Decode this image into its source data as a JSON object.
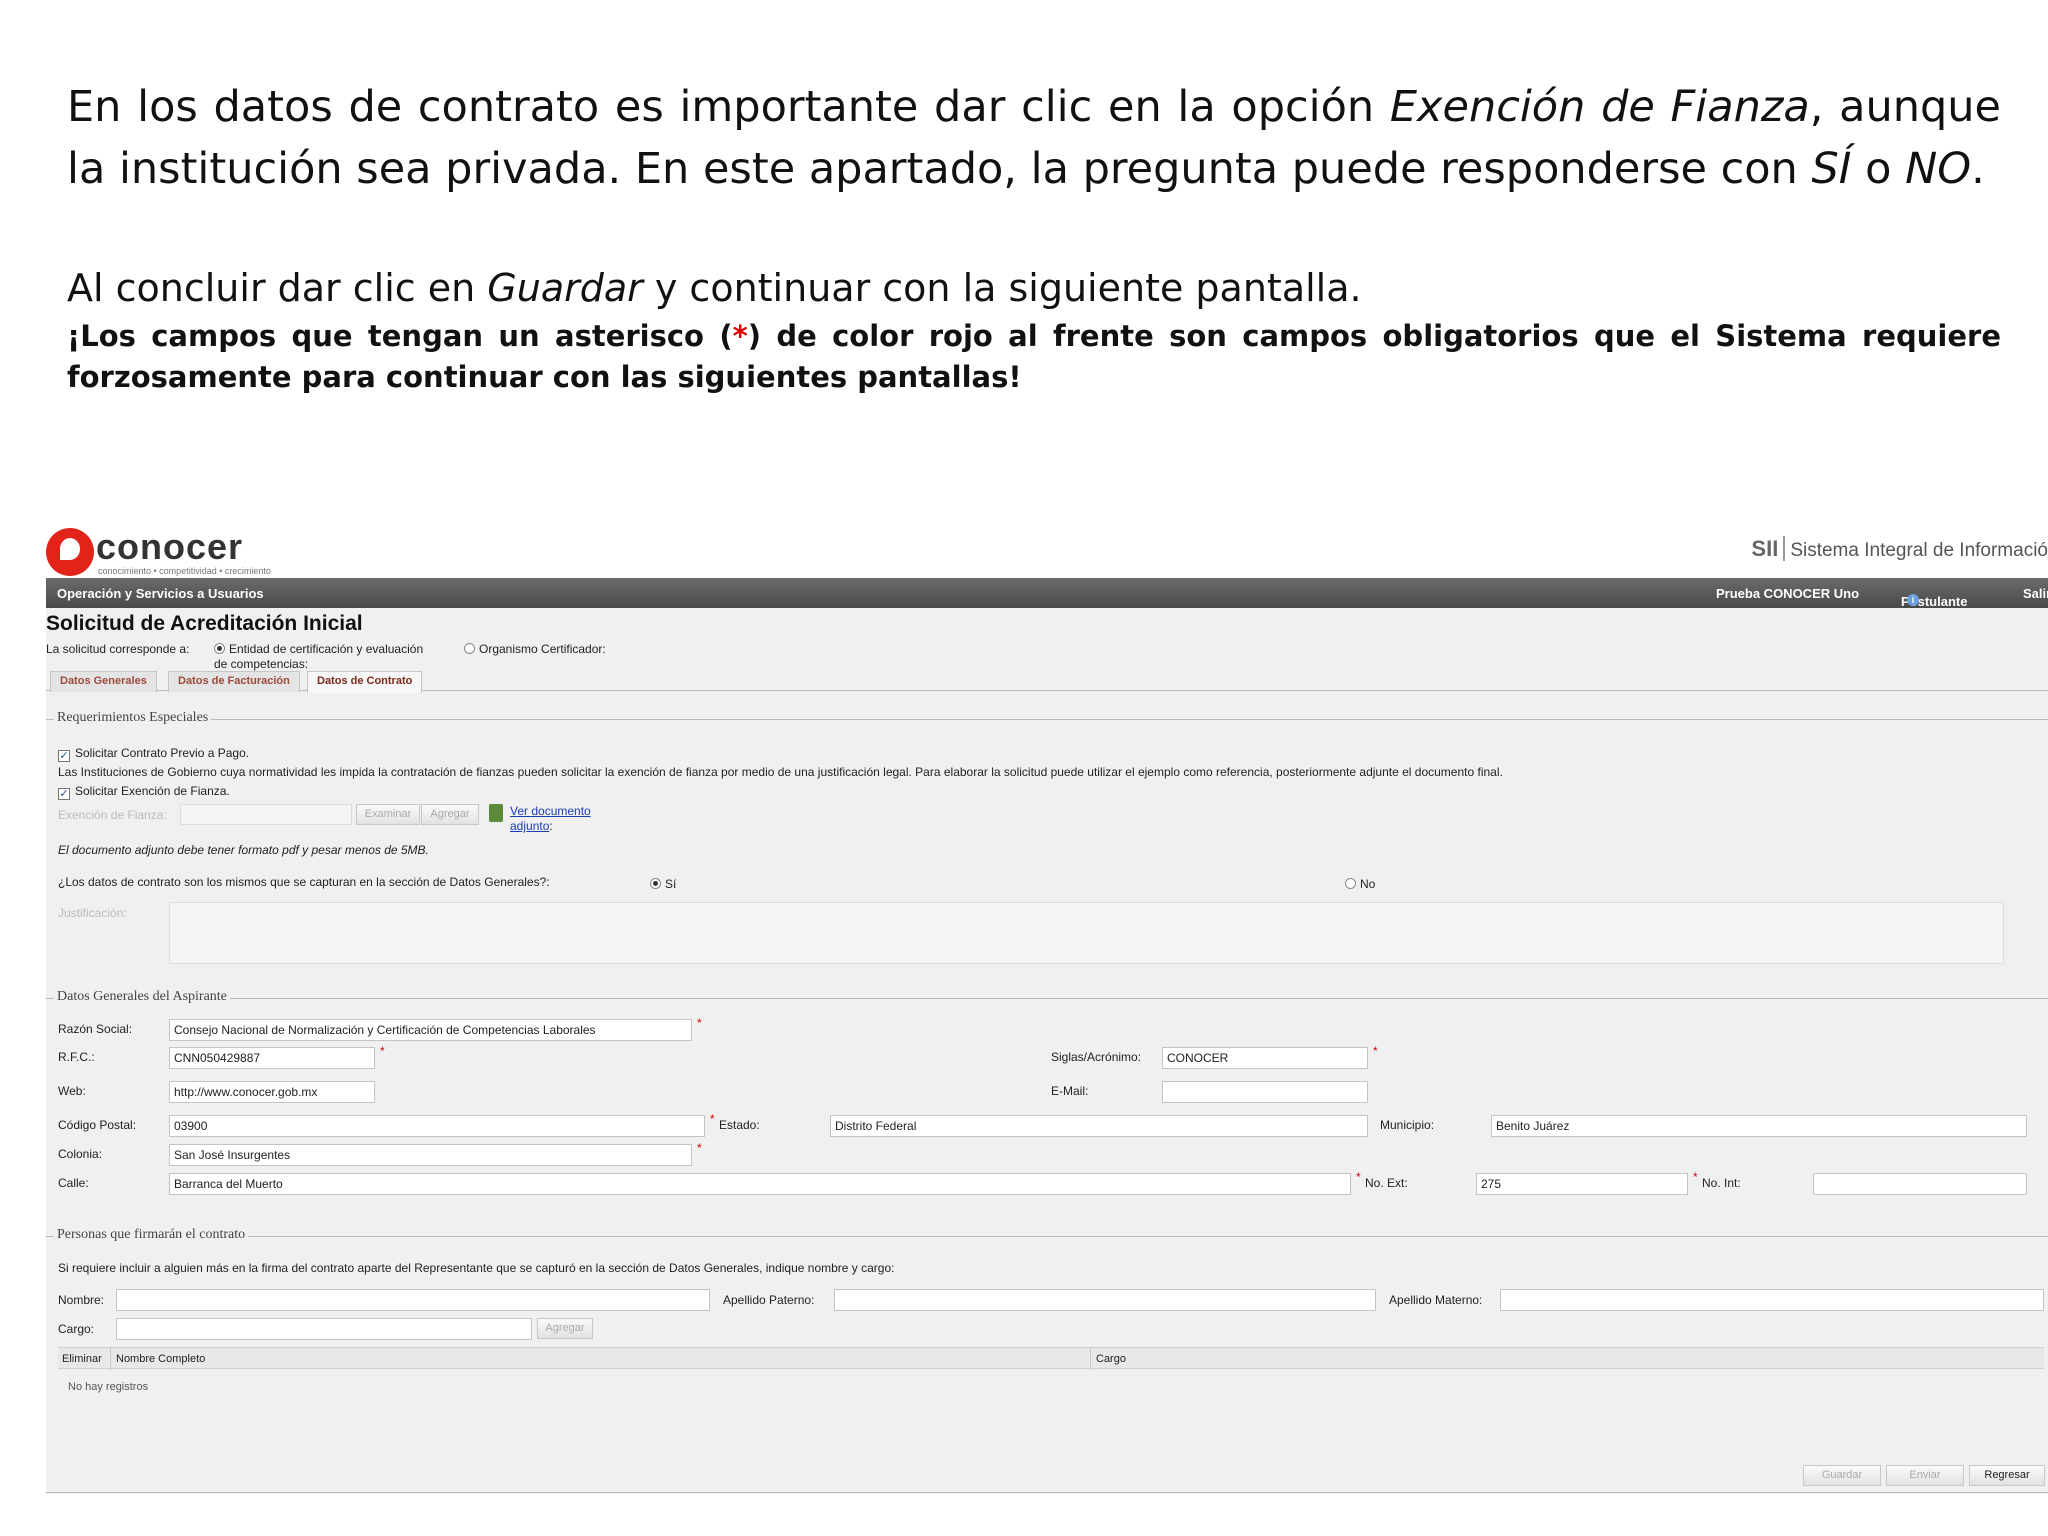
{
  "instructions": {
    "p1_a": "En los datos de contrato es importante dar clic en la opción ",
    "p1_em1": "Exención de Fianza",
    "p1_b": ", aunque la institución sea privada. En este apartado, la pregunta puede responderse con ",
    "p1_em2": "SÍ",
    "p1_c": " o ",
    "p1_em3": "NO",
    "p1_d": ".",
    "p2_a": "Al concluir dar clic en ",
    "p2_em": "Guardar",
    "p2_b": " y continuar con la siguiente pantalla.",
    "p3_a": "¡Los campos que tengan un asterisco (",
    "p3_star": "*",
    "p3_b": ") de color rojo al frente son campos obligatorios que el Sistema requiere forzosamente para continuar con las siguientes pantallas!"
  },
  "header": {
    "logo_text": "conocer",
    "logo_tagline": "conocimiento • competitividad • crecimiento",
    "sii_abbr": "SII",
    "sii_name": "Sistema Integral de Informació"
  },
  "topbar": {
    "menu": "Operación y Servicios a Usuarios",
    "user": "Prueba CONOCER Uno",
    "role": "Postulante",
    "info_glyph": "i",
    "exit": "Salir"
  },
  "form": {
    "title": "Solicitud de Acreditación Inicial",
    "applies_to_label": "La solicitud corresponde a:",
    "option_entity_line1": "Entidad de certificación y evaluación",
    "option_entity_line2": "de competencias:",
    "option_body": "Organismo Certificador:",
    "tabs": [
      "Datos Generales",
      "Datos de Facturación",
      "Datos de Contrato"
    ],
    "special": {
      "legend": "Requerimientos Especiales",
      "check_mark": "✓",
      "check_contract": "Solicitar Contrato Previo a Pago.",
      "gov_note": "Las Instituciones de Gobierno cuya normatividad les impida la contratación de fianzas pueden solicitar la exención de fianza por medio de una justificación legal. Para elaborar la solicitud puede utilizar el ejemplo como referencia, posteriormente adjunte el documento final.",
      "check_exemption": "Solicitar Exención de Fianza.",
      "exemption_label": "Exención de Fianza:",
      "browse_button": "Examinar",
      "add_button": "Agregar",
      "view_doc_line1": "Ver documento",
      "view_doc_line2": "adjunto",
      "view_doc_suffix": ":",
      "file_note": "El documento adjunto debe tener formato pdf y pesar menos de 5MB.",
      "same_data_question": "¿Los datos de contrato son los mismos que se capturan en la sección de Datos Generales?:",
      "yes": "Sí",
      "no": "No",
      "justification_label": "Justificación:"
    },
    "general": {
      "legend": "Datos Generales del Aspirante",
      "required_mark": "*",
      "razon_label": "Razón Social:",
      "razon_value": "Consejo Nacional de Normalización y Certificación de Competencias Laborales",
      "rfc_label": "R.F.C.:",
      "rfc_value": "CNN050429887",
      "siglas_label": "Siglas/Acrónimo:",
      "siglas_value": "CONOCER",
      "web_label": "Web:",
      "web_value": "http://www.conocer.gob.mx",
      "email_label": "E-Mail:",
      "email_value": "",
      "cp_label": "Código Postal:",
      "cp_value": "03900",
      "estado_label": "Estado:",
      "estado_value": "Distrito Federal",
      "municipio_label": "Municipio:",
      "municipio_value": "Benito Juárez",
      "colonia_label": "Colonia:",
      "colonia_value": "San José Insurgentes",
      "calle_label": "Calle:",
      "calle_value": "Barranca del Muerto",
      "noext_label": "No. Ext:",
      "noext_value": "275",
      "noint_label": "No. Int:",
      "noint_value": ""
    },
    "signers": {
      "legend": "Personas que firmarán el contrato",
      "note": "Si requiere incluir a alguien más en la firma del contrato aparte del Representante que se capturó en la sección de Datos Generales, indique nombre y cargo:",
      "nombre_label": "Nombre:",
      "paterno_label": "Apellido Paterno:",
      "materno_label": "Apellido Materno:",
      "cargo_label": "Cargo:",
      "add_button": "Agregar",
      "col_delete": "Eliminar",
      "col_name": "Nombre Completo",
      "col_role": "Cargo",
      "empty": "No hay registros"
    },
    "actions": {
      "save": "Guardar",
      "send": "Enviar",
      "back": "Regresar"
    }
  }
}
